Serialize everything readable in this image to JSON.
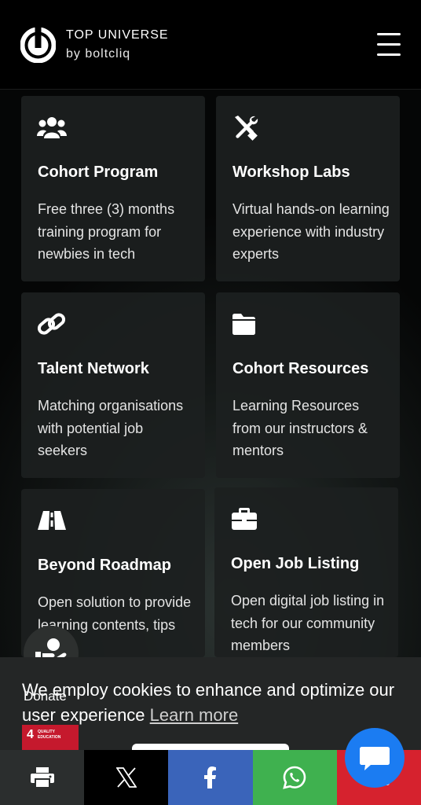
{
  "header": {
    "brand_title": "TOP UNIVERSE",
    "brand_subtitle": "by boltcliq",
    "menu_icon": "hamburger-menu-icon"
  },
  "cards": [
    {
      "icon": "users-group-icon",
      "title": "Cohort Program",
      "description": "Free three (3) months training program for newbies in tech"
    },
    {
      "icon": "tools-icon",
      "title": "Workshop Labs",
      "description": "Virtual hands-on learning experience with industry experts"
    },
    {
      "icon": "link-icon",
      "title": "Talent Network",
      "description": "Matching organisations with potential job seekers"
    },
    {
      "icon": "folder-icon",
      "title": "Cohort Resources",
      "description": "Learning Resources from our instructors & mentors"
    },
    {
      "icon": "road-icon",
      "title": "Beyond Roadmap",
      "description": "Open solution to provide learning contents, tips and"
    },
    {
      "icon": "briefcase-icon",
      "title": "Open Job Listing",
      "description": "Open digital job listing in tech for our community members"
    }
  ],
  "cookie": {
    "message": "We employ cookies to enhance and optimize our user experience",
    "link_label": "Learn more"
  },
  "donate": {
    "label": "Donate",
    "icon": "hand-holding-heart-icon",
    "sdg_number": "4",
    "sdg_label": "QUALITY EDUCATION"
  },
  "chat": {
    "icon": "chat-bubble-icon"
  },
  "share_bar": [
    {
      "name": "print",
      "icon": "print-icon",
      "color": "#2b2e2e"
    },
    {
      "name": "x",
      "icon": "x-logo-icon",
      "color": "#000000"
    },
    {
      "name": "facebook",
      "icon": "facebook-icon",
      "color": "#3a64ba"
    },
    {
      "name": "whatsapp",
      "icon": "whatsapp-icon",
      "color": "#3fb14f"
    },
    {
      "name": "email",
      "icon": "email-icon",
      "color": "#d6222e"
    }
  ]
}
